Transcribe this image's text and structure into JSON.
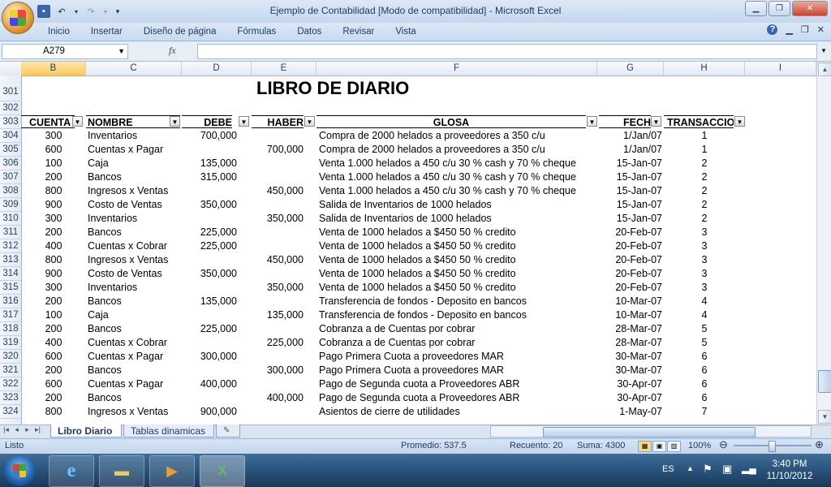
{
  "window": {
    "title": "Ejemplo de Contabilidad  [Modo de compatibilidad] - Microsoft Excel",
    "controls": [
      "▁",
      "❐",
      "✕"
    ]
  },
  "ribbon": {
    "tabs": [
      "Inicio",
      "Insertar",
      "Diseño de página",
      "Fórmulas",
      "Datos",
      "Revisar",
      "Vista"
    ],
    "help": "?",
    "right_controls": [
      "▁",
      "❐",
      "✕"
    ]
  },
  "formula_bar": {
    "name_box": "A279",
    "fx": "fx",
    "formula": ""
  },
  "columns": [
    "B",
    "C",
    "D",
    "E",
    "F",
    "G",
    "H",
    "I"
  ],
  "sheet": {
    "title": "LIBRO DE DIARIO",
    "headers": [
      "CUENTA",
      "NOMBRE",
      "DEBE",
      "HABER",
      "GLOSA",
      "FECH",
      "TRANSACCIO"
    ],
    "top_rows": [
      "301",
      "302",
      "303"
    ],
    "rows": [
      {
        "n": "304",
        "cuenta": "300",
        "nombre": "Inventarios",
        "debe": "700,000",
        "haber": "",
        "glosa": "Compra de 2000 helados a proveedores a 350 c/u",
        "fecha": "1/Jan/07",
        "trans": "1"
      },
      {
        "n": "305",
        "cuenta": "600",
        "nombre": "Cuentas x Pagar",
        "debe": "",
        "haber": "700,000",
        "glosa": "Compra de 2000 helados a proveedores a 350 c/u",
        "fecha": "1/Jan/07",
        "trans": "1"
      },
      {
        "n": "306",
        "cuenta": "100",
        "nombre": "Caja",
        "debe": "135,000",
        "haber": "",
        "glosa": "Venta 1.000 helados a 450 c/u  30 % cash y 70 % cheque",
        "fecha": "15-Jan-07",
        "trans": "2"
      },
      {
        "n": "307",
        "cuenta": "200",
        "nombre": "Bancos",
        "debe": "315,000",
        "haber": "",
        "glosa": "Venta 1.000 helados a 450 c/u  30 % cash y 70 % cheque",
        "fecha": "15-Jan-07",
        "trans": "2"
      },
      {
        "n": "308",
        "cuenta": "800",
        "nombre": "Ingresos x Ventas",
        "debe": "",
        "haber": "450,000",
        "glosa": "Venta 1.000 helados a 450 c/u  30 % cash y 70 % cheque",
        "fecha": "15-Jan-07",
        "trans": "2"
      },
      {
        "n": "309",
        "cuenta": "900",
        "nombre": "Costo de Ventas",
        "debe": "350,000",
        "haber": "",
        "glosa": "Salida de Inventarios de 1000 helados",
        "fecha": "15-Jan-07",
        "trans": "2"
      },
      {
        "n": "310",
        "cuenta": "300",
        "nombre": "Inventarios",
        "debe": "",
        "haber": "350,000",
        "glosa": "Salida de Inventarios de 1000 helados",
        "fecha": "15-Jan-07",
        "trans": "2"
      },
      {
        "n": "311",
        "cuenta": "200",
        "nombre": "Bancos",
        "debe": "225,000",
        "haber": "",
        "glosa": "Venta de 1000 helados  a $450 50 % credito",
        "fecha": "20-Feb-07",
        "trans": "3"
      },
      {
        "n": "312",
        "cuenta": "400",
        "nombre": "Cuentas x Cobrar",
        "debe": "225,000",
        "haber": "",
        "glosa": "Venta de 1000 helados  a $450 50 % credito",
        "fecha": "20-Feb-07",
        "trans": "3"
      },
      {
        "n": "313",
        "cuenta": "800",
        "nombre": "Ingresos x Ventas",
        "debe": "",
        "haber": "450,000",
        "glosa": "Venta de 1000 helados  a $450 50 % credito",
        "fecha": "20-Feb-07",
        "trans": "3"
      },
      {
        "n": "314",
        "cuenta": "900",
        "nombre": "Costo de Ventas",
        "debe": "350,000",
        "haber": "",
        "glosa": "Venta de 1000 helados  a $450 50 % credito",
        "fecha": "20-Feb-07",
        "trans": "3"
      },
      {
        "n": "315",
        "cuenta": "300",
        "nombre": "Inventarios",
        "debe": "",
        "haber": "350,000",
        "glosa": "Venta de 1000 helados  a $450 50 % credito",
        "fecha": "20-Feb-07",
        "trans": "3"
      },
      {
        "n": "316",
        "cuenta": "200",
        "nombre": "Bancos",
        "debe": "135,000",
        "haber": "",
        "glosa": "Transferencia  de fondos - Deposito en bancos",
        "fecha": "10-Mar-07",
        "trans": "4"
      },
      {
        "n": "317",
        "cuenta": "100",
        "nombre": "Caja",
        "debe": "",
        "haber": "135,000",
        "glosa": "Transferencia  de fondos - Deposito en bancos",
        "fecha": "10-Mar-07",
        "trans": "4"
      },
      {
        "n": "318",
        "cuenta": "200",
        "nombre": "Bancos",
        "debe": "225,000",
        "haber": "",
        "glosa": "Cobranza a de Cuentas por cobrar",
        "fecha": "28-Mar-07",
        "trans": "5"
      },
      {
        "n": "319",
        "cuenta": "400",
        "nombre": "Cuentas x Cobrar",
        "debe": "",
        "haber": "225,000",
        "glosa": "Cobranza a de Cuentas por cobrar",
        "fecha": "28-Mar-07",
        "trans": "5"
      },
      {
        "n": "320",
        "cuenta": "600",
        "nombre": "Cuentas x Pagar",
        "debe": "300,000",
        "haber": "",
        "glosa": "Pago Primera Cuota a proveedores MAR",
        "fecha": "30-Mar-07",
        "trans": "6"
      },
      {
        "n": "321",
        "cuenta": "200",
        "nombre": "Bancos",
        "debe": "",
        "haber": "300,000",
        "glosa": "Pago Primera Cuota a proveedores MAR",
        "fecha": "30-Mar-07",
        "trans": "6"
      },
      {
        "n": "322",
        "cuenta": "600",
        "nombre": "Cuentas x Pagar",
        "debe": "400,000",
        "haber": "",
        "glosa": "Pago de Segunda cuota a Proveedores ABR",
        "fecha": "30-Apr-07",
        "trans": "6"
      },
      {
        "n": "323",
        "cuenta": "200",
        "nombre": "Bancos",
        "debe": "",
        "haber": "400,000",
        "glosa": "Pago de Segunda cuota a Proveedores ABR",
        "fecha": "30-Apr-07",
        "trans": "6"
      },
      {
        "n": "324",
        "cuenta": "800",
        "nombre": "Ingresos x Ventas",
        "debe": "900,000",
        "haber": "",
        "glosa": "Asientos de cierre de utilidades",
        "fecha": "1-May-07",
        "trans": "7"
      }
    ]
  },
  "sheet_tabs": [
    "Libro Diario",
    "Tablas dinamicas"
  ],
  "status": {
    "mode": "Listo",
    "promedio": "Promedio: 537.5",
    "recuento": "Recuento: 20",
    "suma": "Suma: 4300",
    "zoom": "100%"
  },
  "taskbar": {
    "language": "ES",
    "time": "3:40 PM",
    "date": "11/10/2012"
  },
  "colors": {
    "accent": "#1e395b",
    "selected_header": "#f9c65c",
    "taskbar": "#17385a"
  }
}
